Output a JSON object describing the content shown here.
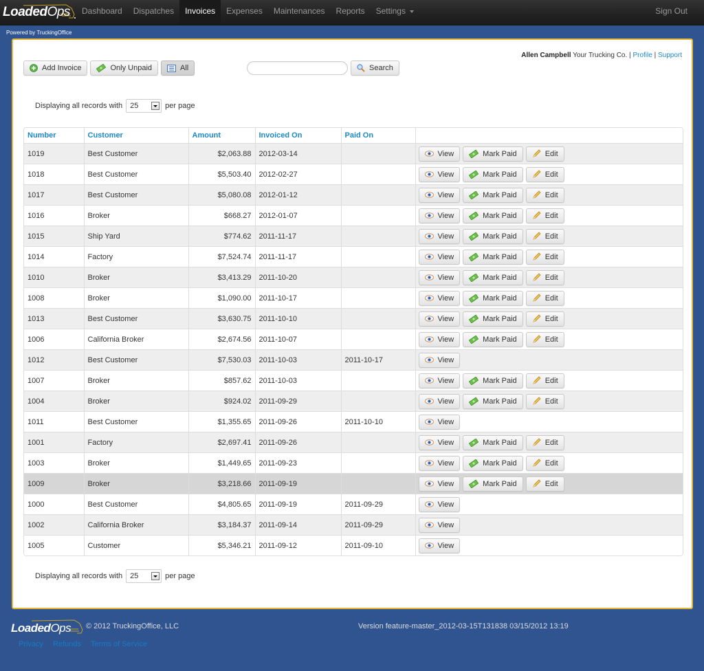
{
  "brand": {
    "name_bold": "Loaded",
    "name_light": "Ops"
  },
  "nav": {
    "items": [
      {
        "label": "Dashboard",
        "active": false
      },
      {
        "label": "Dispatches",
        "active": false
      },
      {
        "label": "Invoices",
        "active": true
      },
      {
        "label": "Expenses",
        "active": false
      },
      {
        "label": "Maintenances",
        "active": false
      },
      {
        "label": "Reports",
        "active": false
      },
      {
        "label": "Settings",
        "active": false,
        "dropdown": true
      }
    ],
    "sign_out": "Sign Out"
  },
  "powered_by": "Powered by TruckingOffice",
  "user": {
    "name": "Allen Campbell",
    "company": "Your Trucking Co.",
    "separator": "|",
    "profile_link": "Profile",
    "support_link": "Support"
  },
  "toolbar": {
    "add_invoice": "Add Invoice",
    "only_unpaid": "Only Unpaid",
    "all": "All",
    "search_value": "",
    "search_placeholder": "",
    "search_button": "Search"
  },
  "pagination": {
    "prefix": "Displaying all records with",
    "per_page_value": "25",
    "suffix": "per page"
  },
  "table": {
    "columns": [
      "Number",
      "Customer",
      "Amount",
      "Invoiced On",
      "Paid On",
      ""
    ],
    "action_labels": {
      "view": "View",
      "mark_paid": "Mark Paid",
      "edit": "Edit"
    },
    "rows": [
      {
        "number": "1019",
        "customer": "Best Customer",
        "amount": "$2,063.88",
        "invoiced_on": "2012-03-14",
        "paid_on": "",
        "paid": false
      },
      {
        "number": "1018",
        "customer": "Best Customer",
        "amount": "$5,503.40",
        "invoiced_on": "2012-02-27",
        "paid_on": "",
        "paid": false
      },
      {
        "number": "1017",
        "customer": "Best Customer",
        "amount": "$5,080.08",
        "invoiced_on": "2012-01-12",
        "paid_on": "",
        "paid": false
      },
      {
        "number": "1016",
        "customer": "Broker",
        "amount": "$668.27",
        "invoiced_on": "2012-01-07",
        "paid_on": "",
        "paid": false
      },
      {
        "number": "1015",
        "customer": "Ship Yard",
        "amount": "$774.62",
        "invoiced_on": "2011-11-17",
        "paid_on": "",
        "paid": false
      },
      {
        "number": "1014",
        "customer": "Factory",
        "amount": "$7,524.74",
        "invoiced_on": "2011-11-17",
        "paid_on": "",
        "paid": false
      },
      {
        "number": "1010",
        "customer": "Broker",
        "amount": "$3,413.29",
        "invoiced_on": "2011-10-20",
        "paid_on": "",
        "paid": false
      },
      {
        "number": "1008",
        "customer": "Broker",
        "amount": "$1,090.00",
        "invoiced_on": "2011-10-17",
        "paid_on": "",
        "paid": false
      },
      {
        "number": "1013",
        "customer": "Best Customer",
        "amount": "$3,630.75",
        "invoiced_on": "2011-10-10",
        "paid_on": "",
        "paid": false
      },
      {
        "number": "1006",
        "customer": "California Broker",
        "amount": "$2,674.56",
        "invoiced_on": "2011-10-07",
        "paid_on": "",
        "paid": false
      },
      {
        "number": "1012",
        "customer": "Best Customer",
        "amount": "$7,530.03",
        "invoiced_on": "2011-10-03",
        "paid_on": "2011-10-17",
        "paid": true
      },
      {
        "number": "1007",
        "customer": "Broker",
        "amount": "$857.62",
        "invoiced_on": "2011-10-03",
        "paid_on": "",
        "paid": false
      },
      {
        "number": "1004",
        "customer": "Broker",
        "amount": "$924.02",
        "invoiced_on": "2011-09-29",
        "paid_on": "",
        "paid": false
      },
      {
        "number": "1011",
        "customer": "Best Customer",
        "amount": "$1,355.65",
        "invoiced_on": "2011-09-26",
        "paid_on": "2011-10-10",
        "paid": true
      },
      {
        "number": "1001",
        "customer": "Factory",
        "amount": "$2,697.41",
        "invoiced_on": "2011-09-26",
        "paid_on": "",
        "paid": false
      },
      {
        "number": "1003",
        "customer": "Broker",
        "amount": "$1,449.65",
        "invoiced_on": "2011-09-23",
        "paid_on": "",
        "paid": false
      },
      {
        "number": "1009",
        "customer": "Broker",
        "amount": "$3,218.66",
        "invoiced_on": "2011-09-19",
        "paid_on": "",
        "paid": false,
        "highlighted": true
      },
      {
        "number": "1000",
        "customer": "Best Customer",
        "amount": "$4,805.65",
        "invoiced_on": "2011-09-19",
        "paid_on": "2011-09-29",
        "paid": true
      },
      {
        "number": "1002",
        "customer": "California Broker",
        "amount": "$3,184.37",
        "invoiced_on": "2011-09-14",
        "paid_on": "2011-09-29",
        "paid": true
      },
      {
        "number": "1005",
        "customer": "Customer",
        "amount": "$5,346.21",
        "invoiced_on": "2011-09-12",
        "paid_on": "2011-09-10",
        "paid": true
      }
    ]
  },
  "footer": {
    "copyright": "© 2012 TruckingOffice, LLC",
    "version": "Version feature-master_2012-03-15T131838 03/15/2012 13:19",
    "links": [
      "Privacy",
      "Refunds",
      "Terms of Service"
    ]
  },
  "colors": {
    "page_bg": "#2f5490",
    "panel_border": "#e4b433",
    "link": "#1e88c7",
    "navbar": "#222222",
    "row_stripe": "#eeeeee",
    "row_highlight": "#d6d6d6"
  }
}
